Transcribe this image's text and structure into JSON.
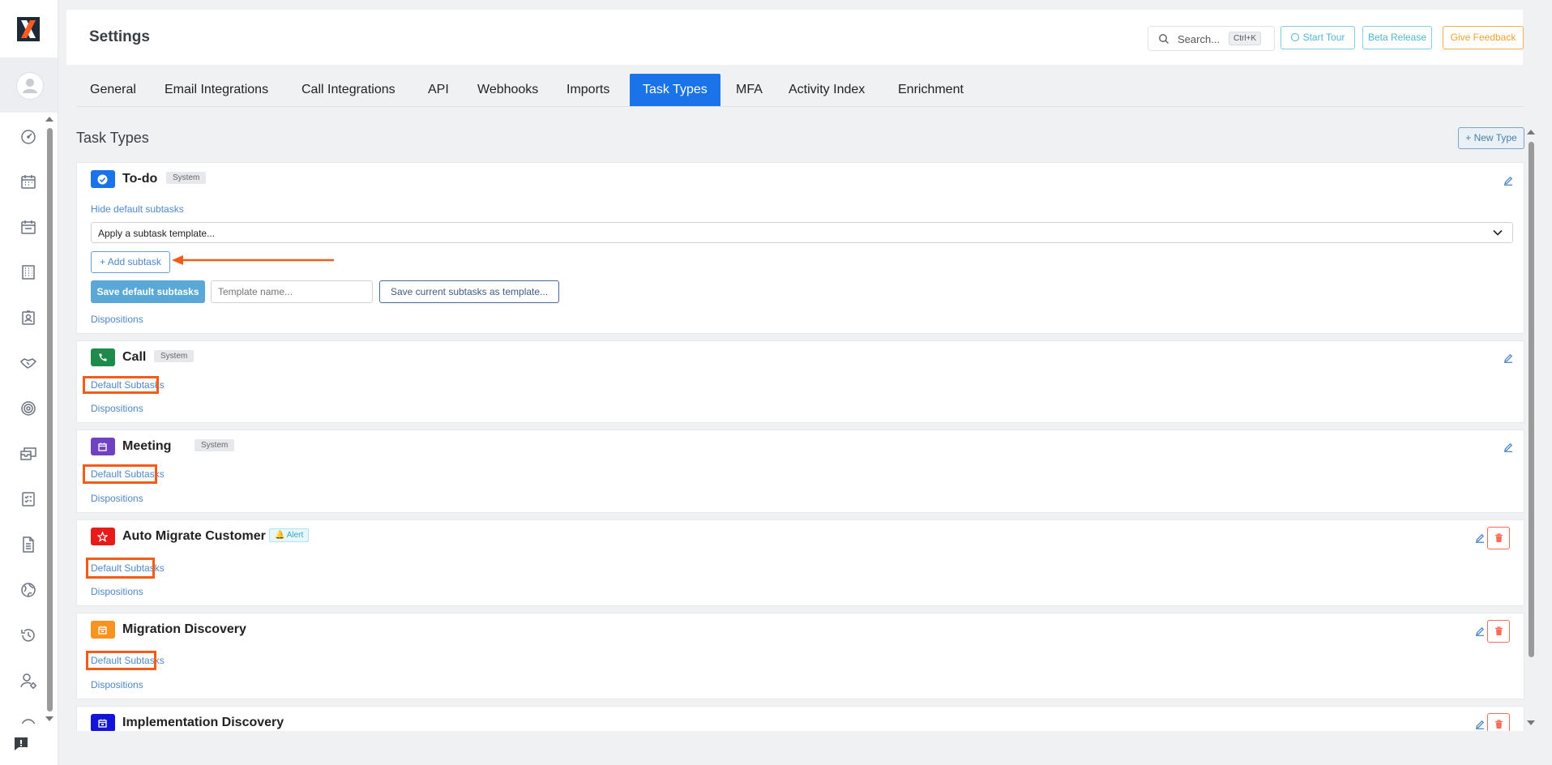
{
  "app": {
    "page_title": "Settings"
  },
  "header": {
    "search_placeholder": "Search...",
    "search_shortcut": "Ctrl+K",
    "start_tour": "Start Tour",
    "beta_release": "Beta Release",
    "give_feedback": "Give Feedback"
  },
  "tabs": [
    {
      "label": "General"
    },
    {
      "label": "Email Integrations"
    },
    {
      "label": "Call Integrations"
    },
    {
      "label": "API"
    },
    {
      "label": "Webhooks"
    },
    {
      "label": "Imports"
    },
    {
      "label": "Task Types",
      "active": true
    },
    {
      "label": "MFA"
    },
    {
      "label": "Activity Index"
    },
    {
      "label": "Enrichment"
    }
  ],
  "section": {
    "title": "Task Types",
    "new_type": "+ New Type"
  },
  "task_types": [
    {
      "name": "To-do",
      "badge": "System",
      "icon": "check-circle-icon",
      "color": "#1a73e8",
      "expanded": true,
      "hide_default_subtasks": "Hide default subtasks",
      "subtask_template_select": "Apply a subtask template...",
      "add_subtask": "+ Add subtask",
      "save_default_subtasks": "Save default subtasks",
      "template_name_placeholder": "Template name...",
      "save_as_template": "Save current subtasks as template...",
      "dispositions": "Dispositions"
    },
    {
      "name": "Call",
      "badge": "System",
      "icon": "phone-icon",
      "color": "#1e8a4c",
      "default_subtasks": "Default Subtasks",
      "dispositions": "Dispositions"
    },
    {
      "name": "Meeting",
      "badge": "System",
      "icon": "calendar-icon",
      "color": "#6f42c1",
      "default_subtasks": "Default Subtasks",
      "dispositions": "Dispositions"
    },
    {
      "name": "Auto Migrate Customer",
      "badge": "Alert",
      "badge_icon": "bell-icon",
      "icon": "star-icon",
      "color": "#e81b1b",
      "default_subtasks": "Default Subtasks",
      "dispositions": "Dispositions"
    },
    {
      "name": "Migration Discovery",
      "icon": "calendar-icon",
      "color": "#f7931e",
      "default_subtasks": "Default Subtasks",
      "dispositions": "Dispositions"
    },
    {
      "name": "Implementation Discovery",
      "icon": "calendar-icon",
      "color": "#1414d9"
    }
  ],
  "sidebar_icons": [
    "dashboard-gauge-icon",
    "calendar-icon",
    "calendar-icon",
    "building-icon",
    "contact-card-icon",
    "handshake-icon",
    "target-icon",
    "inbox-icon",
    "checklist-icon",
    "document-icon",
    "globe-icon",
    "history-icon",
    "user-settings-icon",
    "help-icon"
  ],
  "colors": {
    "accent": "#1a73e8",
    "annotation": "#f25c17",
    "link": "#4f88c6",
    "feedback": "#f0a030",
    "info": "#4fb6cc"
  }
}
